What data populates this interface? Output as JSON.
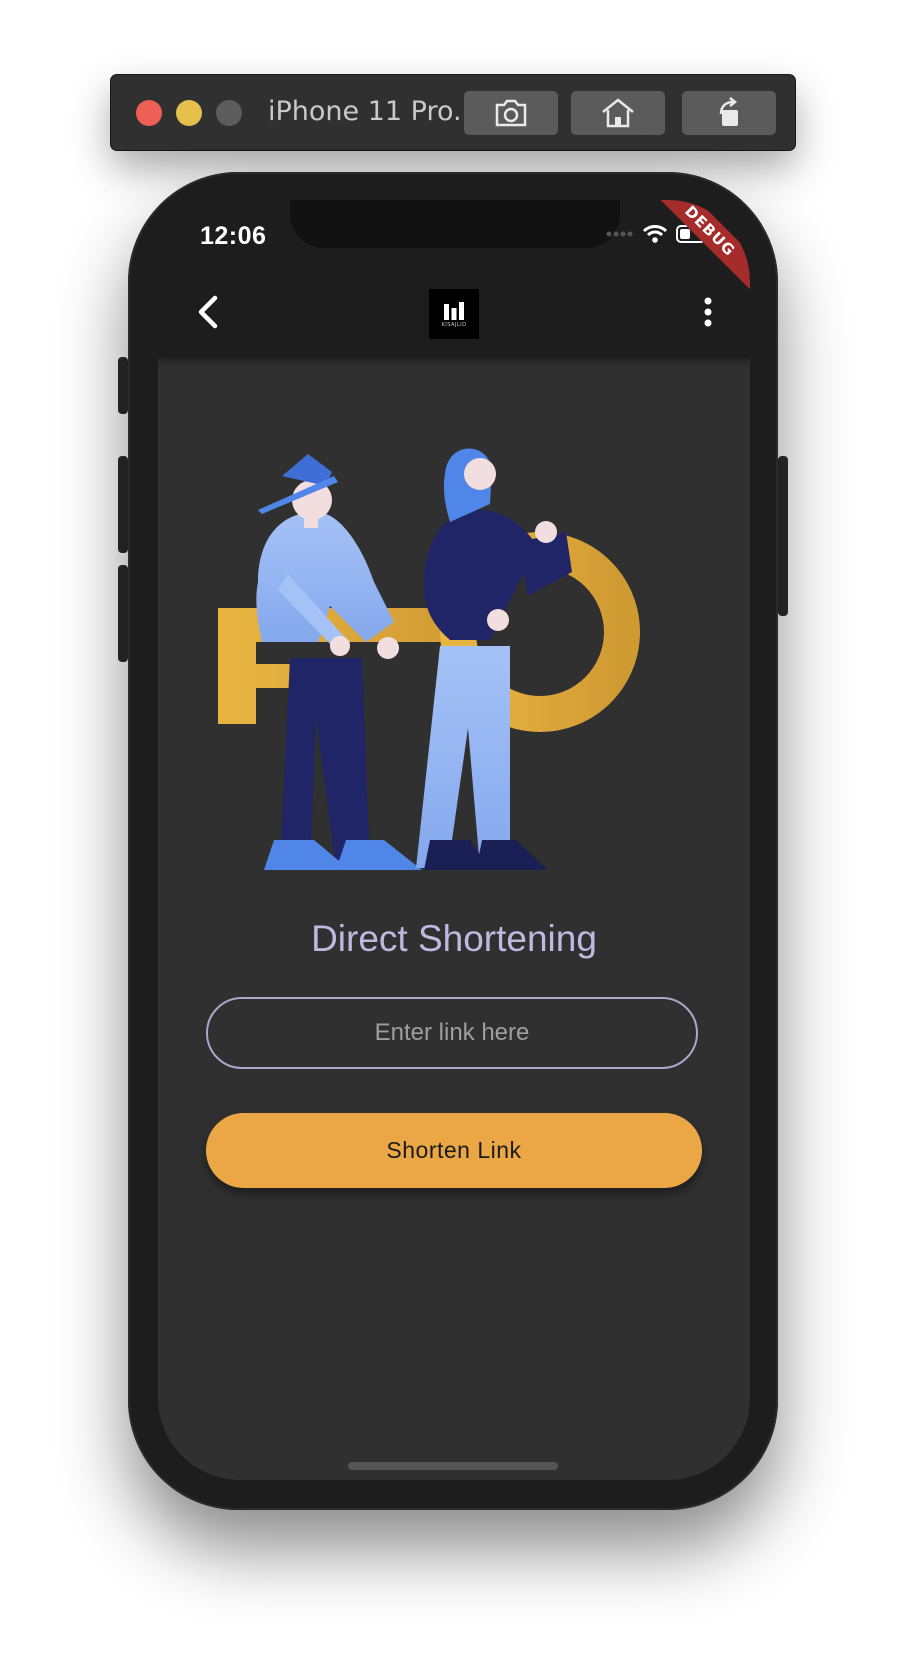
{
  "window": {
    "title": "iPhone 11 Pro...",
    "buttons": [
      "screenshot-icon",
      "home-icon",
      "rotate-icon"
    ]
  },
  "status_bar": {
    "time": "12:06",
    "debug_banner": "DEBUG"
  },
  "app_bar": {
    "logo_sub": "KISAJLID",
    "icons": [
      "back-arrow-icon",
      "more-vert-icon"
    ]
  },
  "main": {
    "heading": "Direct Shortening",
    "link_input": {
      "placeholder": "Enter link here",
      "value": ""
    },
    "shorten_button": "Shorten Link"
  },
  "colors": {
    "accent": "#eba745",
    "heading": "#bfb9e0",
    "background": "#303030",
    "app_bar": "#1d1d1d"
  }
}
